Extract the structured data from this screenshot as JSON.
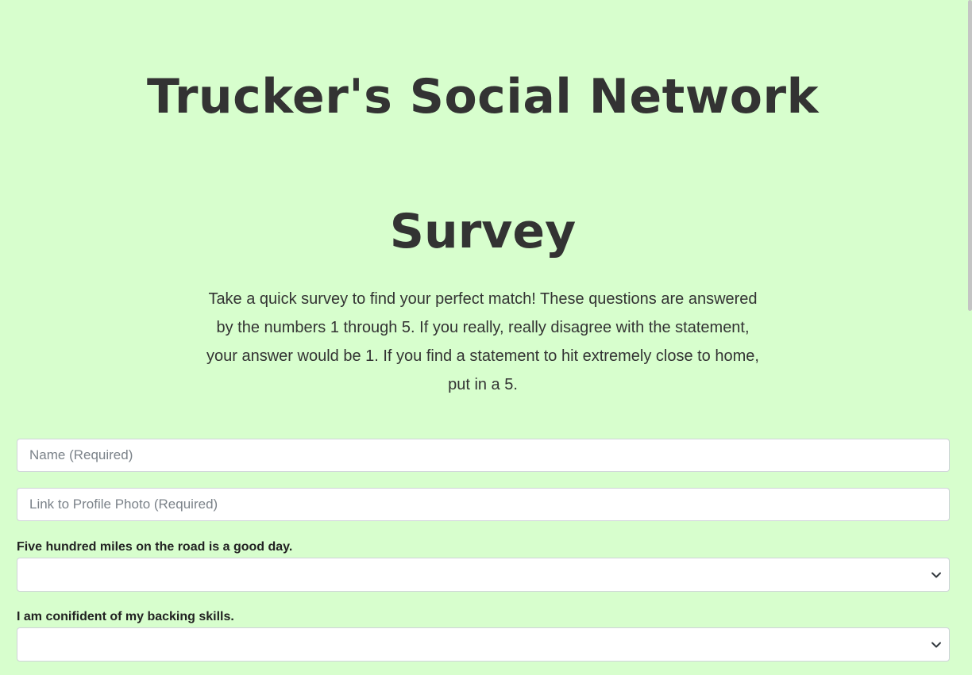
{
  "header": {
    "site_title": "Trucker's Social Network"
  },
  "survey": {
    "title": "Survey",
    "intro": "Take a quick survey to find your perfect match! These questions are answered by the numbers 1 through 5. If you really, really disagree with the statement, your answer would be 1. If you find a statement to hit extremely close to home, put in a 5.",
    "name_placeholder": "Name (Required)",
    "photo_placeholder": "Link to Profile Photo (Required)",
    "questions": [
      {
        "label": "Five hundred miles on the road is a good day.",
        "selected": ""
      },
      {
        "label": "I am conifident of my backing skills.",
        "selected": ""
      }
    ]
  },
  "colors": {
    "background": "#d7fecd",
    "text": "#333333",
    "input_border": "#cfd4d9"
  },
  "icons": {
    "select_chevron": "chevron-down-icon"
  }
}
